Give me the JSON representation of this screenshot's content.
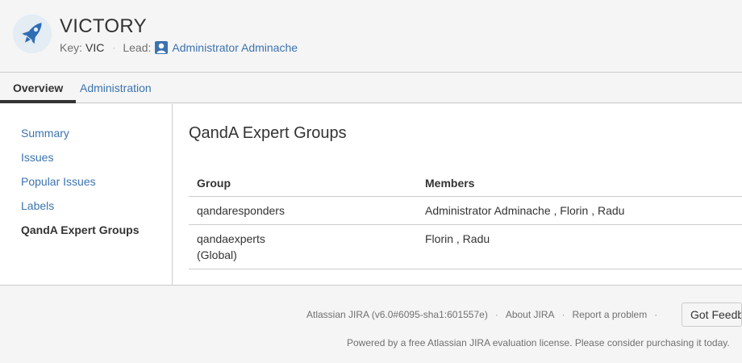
{
  "header": {
    "title": "VICTORY",
    "key_label": "Key:",
    "key_value": "VIC",
    "separator": "·",
    "lead_label": "Lead:",
    "lead_name": "Administrator Adminache"
  },
  "nav": {
    "tabs": [
      {
        "label": "Overview",
        "active": true
      },
      {
        "label": "Administration",
        "active": false
      }
    ]
  },
  "sidebar": {
    "items": [
      {
        "label": "Summary",
        "active": false
      },
      {
        "label": "Issues",
        "active": false
      },
      {
        "label": "Popular Issues",
        "active": false
      },
      {
        "label": "Labels",
        "active": false
      },
      {
        "label": "QandA Expert Groups",
        "active": true
      }
    ]
  },
  "main": {
    "title": "QandA Expert Groups",
    "table": {
      "headers": [
        "Group",
        "Members"
      ],
      "rows": [
        {
          "group": "qandaresponders",
          "group_note": "",
          "members": "Administrator Adminache , Florin , Radu"
        },
        {
          "group": "qandaexperts",
          "group_note": "(Global)",
          "members": "Florin , Radu"
        }
      ]
    }
  },
  "footer": {
    "version": "Atlassian JIRA (v6.0#6095-sha1:601557e)",
    "separator": "·",
    "about": "About JIRA",
    "report": "Report a problem",
    "feedback_button": "Got Feedback?",
    "powered": "Powered by a free Atlassian JIRA evaluation license. Please consider purchasing it today."
  },
  "colors": {
    "link": "#3b73af",
    "text": "#333333",
    "muted": "#707070",
    "background": "#f5f5f5",
    "border": "#cccccc"
  },
  "icons": {
    "project_avatar": "rocket-icon",
    "lead_avatar": "user-avatar-icon"
  }
}
